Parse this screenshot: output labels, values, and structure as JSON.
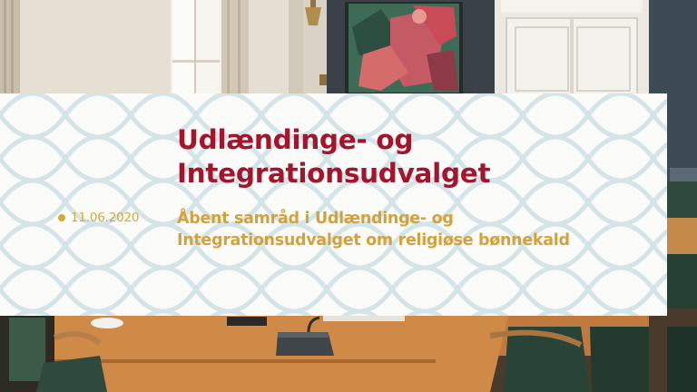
{
  "overlay": {
    "title_line1": "Udlændinge- og",
    "title_line2": "Integrationsudvalget",
    "date": "11.06.2020",
    "subtitle_line1": "Åbent samråd i Udlændinge- og",
    "subtitle_line2": "Integrationsudvalget om religiøse bønnekald"
  },
  "colors": {
    "title": "#a3152b",
    "accent_gold": "#d7a73c",
    "panel_background": "#fbfbfa",
    "pattern_line": "#c7dde4"
  }
}
